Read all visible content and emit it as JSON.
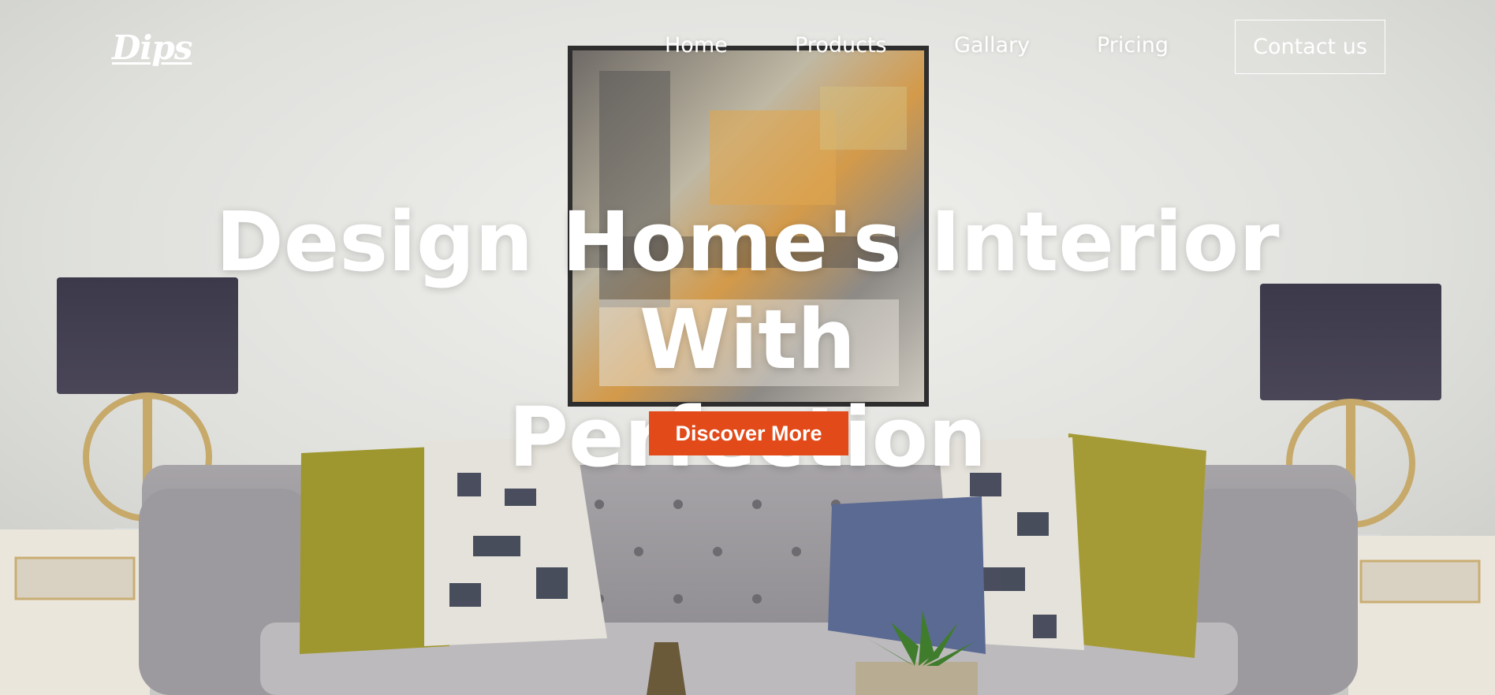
{
  "brand": {
    "logo_text": "Dips"
  },
  "nav": {
    "items": [
      {
        "label": "Home"
      },
      {
        "label": "Products"
      },
      {
        "label": "Gallary"
      },
      {
        "label": "Pricing"
      }
    ],
    "contact_label": "Contact us"
  },
  "hero": {
    "headline_line1": "Design Home's Interior With",
    "headline_line2": "Perfection",
    "cta_label": "Discover More",
    "cta_color": "#e24a19",
    "background": "living room interior with tufted gray sofa, abstract painting, two table lamps"
  }
}
